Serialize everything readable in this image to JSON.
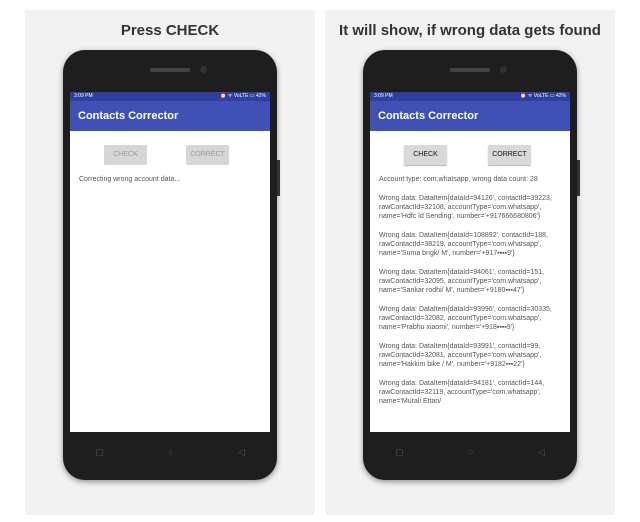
{
  "left": {
    "caption": "Press CHECK",
    "status": {
      "time": "3:09 PM",
      "icons": "⏰ ᯤ VoLTE ▭ 42%"
    },
    "app_title": "Contacts Corrector",
    "buttons": {
      "check": "CHECK",
      "correct": "CORRECT"
    },
    "message": "Correcting wrong account data..."
  },
  "right": {
    "caption": "It will show, if wrong data gets found",
    "status": {
      "time": "3:09 PM",
      "icons": "⏰ ᯤ VoLTE ▭ 42%"
    },
    "app_title": "Contacts Corrector",
    "buttons": {
      "check": "CHECK",
      "correct": "CORRECT"
    },
    "summary": "Account type: com.whatsapp, wrong data count: 28",
    "entries": [
      "Wrong data: DataItem{dataId=94126', contactId=39223, rawContactId=32108, accountType='com.whatsapp', name='Hdfc ld Sending', number='+917666680806'}",
      "Wrong data: DataItem{dataId=108892', contactId=188, rawContactId=38219, accountType='com.whatsapp', name='Suma bngk/ M', number='+917▪▪▪▪9'}",
      "Wrong data: DataItem{dataId=94061', contactId=151, rawContactId=32095, accountType='com.whatsapp', name='Sankar rodhi/ M', number='+9180▪▪▪47'}",
      "Wrong data: DataItem{dataId=93996', contactId=30335, rawContactId=32082, accountType='com.whatsapp', name='Prabhu xiaomi', number='+918▪▪▪▪9'}",
      "Wrong data: DataItem{dataId=93991', contactId=99, rawContactId=32081, accountType='com.whatsapp', name='Hakkim bike / M', number='+9182▪▪▪22'}",
      "Wrong data: DataItem{dataId=94181', contactId=144, rawContactId=32119, accountType='com.whatsapp', name='Murali Ettan/"
    ]
  },
  "navbar": {
    "recent": "▢",
    "home": "○",
    "back": "◁"
  },
  "colors": {
    "appbar": "#3f51b5",
    "statusbar": "#2f3f9f"
  }
}
